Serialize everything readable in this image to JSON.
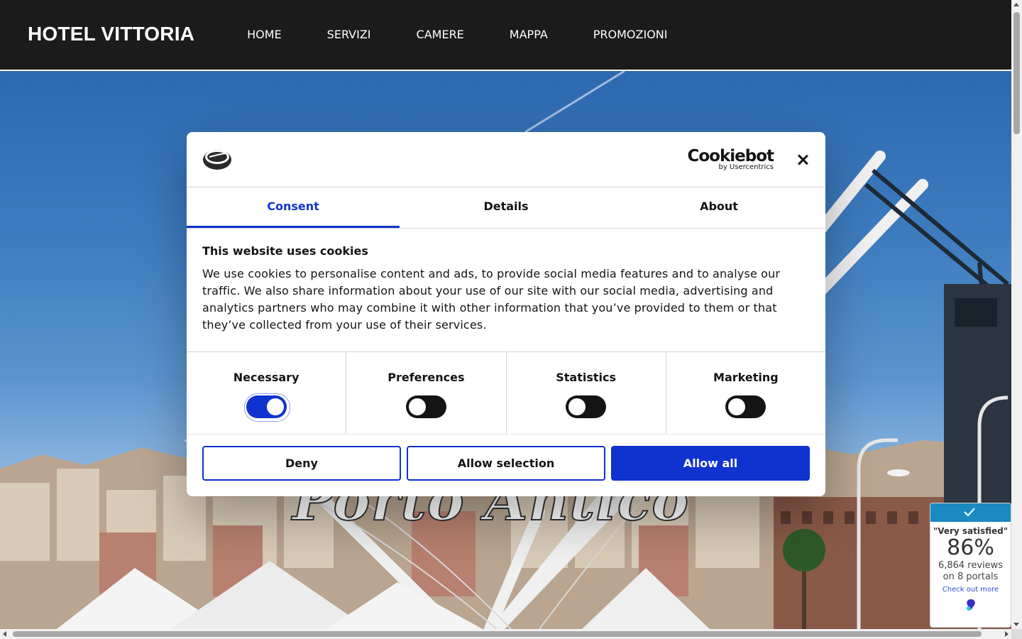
{
  "header": {
    "logo": "HOTEL VITTORIA",
    "nav": [
      "HOME",
      "SERVIZI",
      "CAMERE",
      "MAPPA",
      "PROMOZIONI"
    ]
  },
  "hero": {
    "caption": "Porto Antico"
  },
  "cookie_dialog": {
    "brand": "Cookiebot",
    "brand_sub": "by Usercentrics",
    "tabs": [
      "Consent",
      "Details",
      "About"
    ],
    "active_tab": "Consent",
    "title": "This website uses cookies",
    "description": "We use cookies to personalise content and ads, to provide social media features and to analyse our traffic. We also share information about your use of our site with our social media, advertising and analytics partners who may combine it with other information that you’ve provided to them or that they’ve collected from your use of their services.",
    "toggles": [
      {
        "label": "Necessary",
        "on": true
      },
      {
        "label": "Preferences",
        "on": false
      },
      {
        "label": "Statistics",
        "on": false
      },
      {
        "label": "Marketing",
        "on": false
      }
    ],
    "buttons": {
      "deny": "Deny",
      "allow_selection": "Allow selection",
      "allow_all": "Allow all"
    },
    "colors": {
      "accent": "#1032cf",
      "text": "#141414"
    }
  },
  "review_widget": {
    "quote": "\"Very satisfied\"",
    "percent": "86%",
    "reviews": "6,864 reviews",
    "portals": "on 8 portals",
    "link": "Check out more",
    "accent": "#1a8ac0"
  }
}
